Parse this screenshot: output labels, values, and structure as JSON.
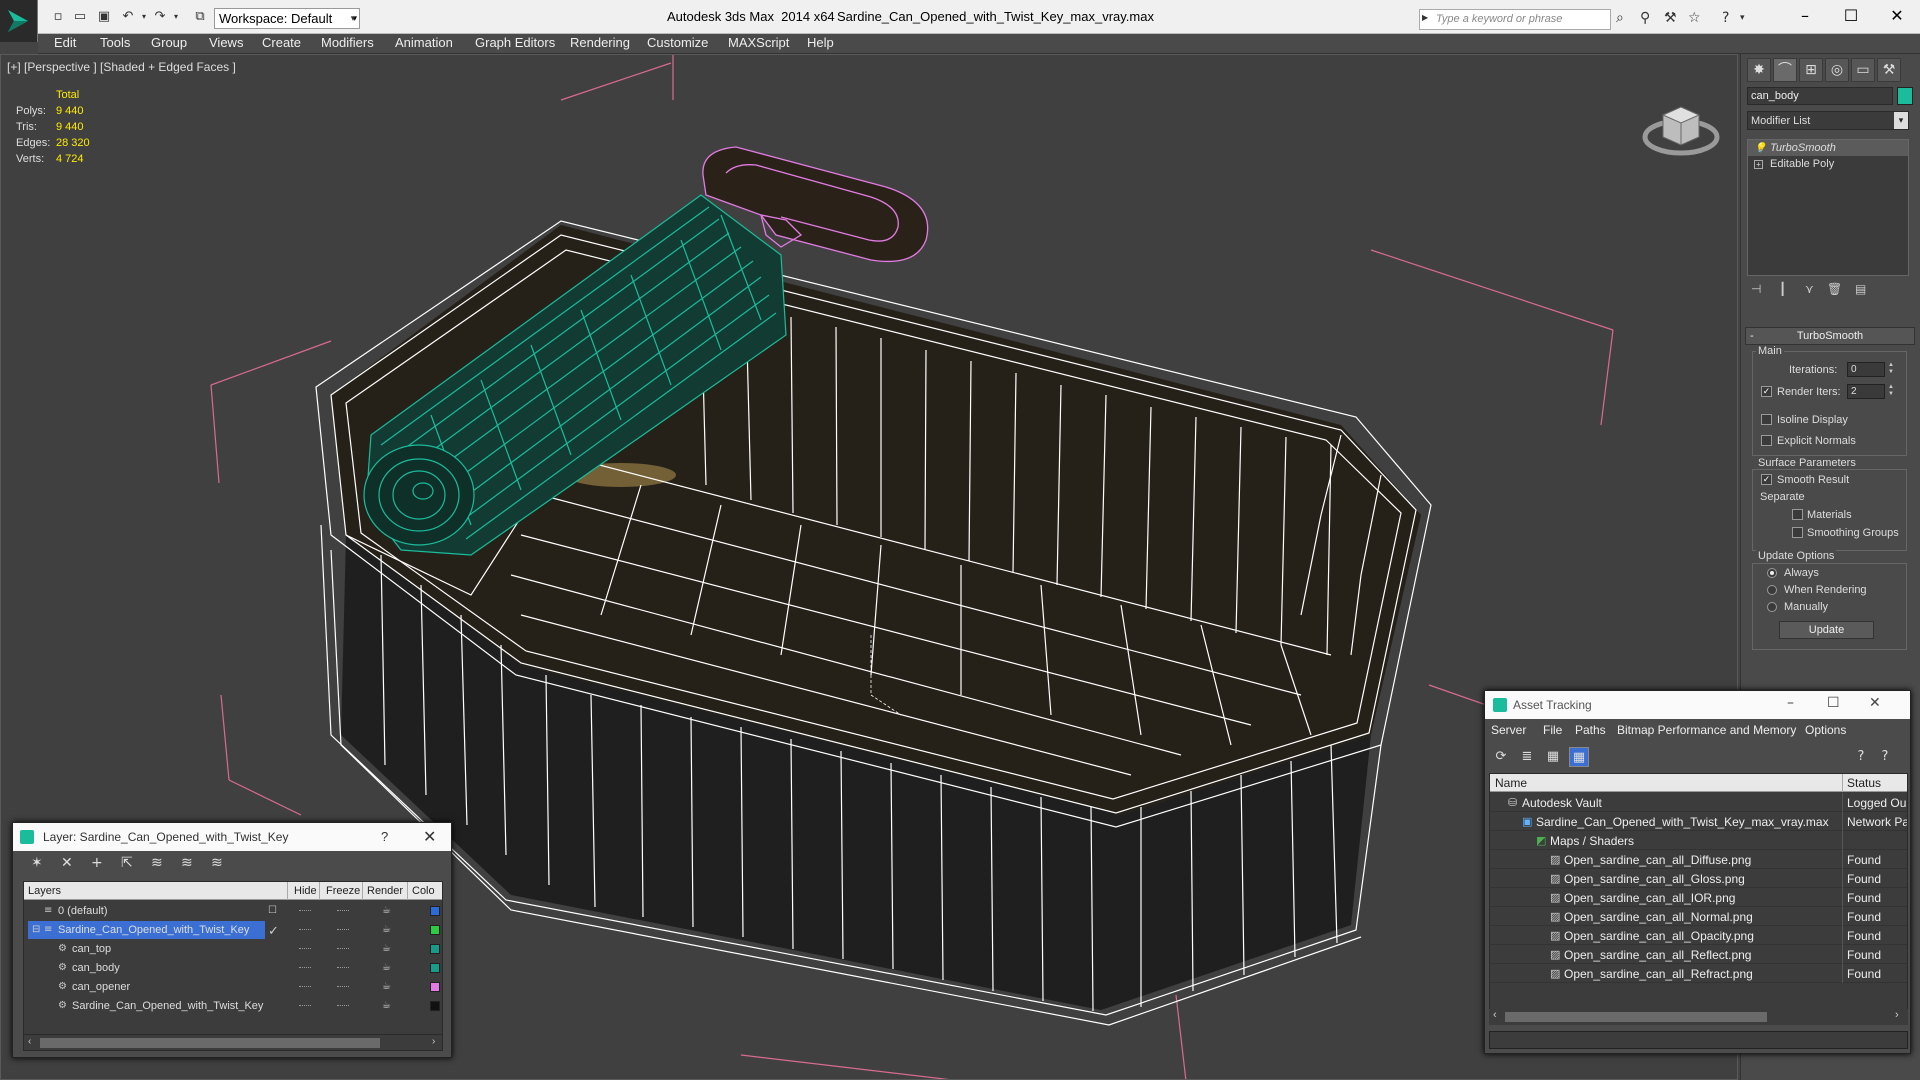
{
  "titlebar": {
    "workspace": "Workspace: Default",
    "app_title": "Autodesk 3ds Max  2014 x64",
    "file_title": "Sardine_Can_Opened_with_Twist_Key_max_vray.max",
    "search_placeholder": "Type a keyword or phrase"
  },
  "menu": [
    "Edit",
    "Tools",
    "Group",
    "Views",
    "Create",
    "Modifiers",
    "Animation",
    "Graph Editors",
    "Rendering",
    "Customize",
    "MAXScript",
    "Help"
  ],
  "viewport": {
    "label": "[+] [Perspective ] [Shaded + Edged Faces ]",
    "stats_total": "Total",
    "stats": [
      {
        "k": "Polys:",
        "v": "9 440"
      },
      {
        "k": "Tris:",
        "v": "9 440"
      },
      {
        "k": "Edges:",
        "v": "28 320"
      },
      {
        "k": "Verts:",
        "v": "4 724"
      }
    ],
    "colors": {
      "background": "#404040",
      "wire": "#ffffff",
      "key": "#1abc9c",
      "ring": "#e27be3",
      "grid": "#d96b8f"
    }
  },
  "command_panel": {
    "object_name": "can_body",
    "object_color": "#1abc9c",
    "modifier_list": "Modifier List",
    "stack": [
      "TurboSmooth",
      "Editable Poly"
    ],
    "rollout": "TurboSmooth",
    "main_label": "Main",
    "iterations_label": "Iterations:",
    "iterations_value": "0",
    "render_iters_label": "Render Iters:",
    "render_iters_value": "2",
    "isoline": "Isoline Display",
    "explicit_normals": "Explicit Normals",
    "surface_params": "Surface Parameters",
    "smooth_result": "Smooth Result",
    "separate": "Separate",
    "materials": "Materials",
    "smoothing_groups": "Smoothing Groups",
    "update_options": "Update Options",
    "always": "Always",
    "when_rendering": "When Rendering",
    "manually": "Manually",
    "update_button": "Update"
  },
  "layer_window": {
    "title": "Layer: Sardine_Can_Opened_with_Twist_Key",
    "help": "?",
    "columns": [
      "Layers",
      "Hide",
      "Freeze",
      "Render",
      "Colo"
    ],
    "rows": [
      {
        "name": "0 (default)",
        "color": "#2b6ad9"
      },
      {
        "name": "Sardine_Can_Opened_with_Twist_Key",
        "color": "#2ecc40"
      },
      {
        "name": "can_top",
        "color": "#1a9b8a"
      },
      {
        "name": "can_body",
        "color": "#1a9b8a"
      },
      {
        "name": "can_opener",
        "color": "#e27be3"
      },
      {
        "name": "Sardine_Can_Opened_with_Twist_Key",
        "color": "#111111"
      }
    ]
  },
  "asset_window": {
    "title": "Asset Tracking",
    "menu": [
      "Server",
      "File",
      "Paths",
      "Bitmap Performance and Memory",
      "Options"
    ],
    "columns": [
      "Name",
      "Status"
    ],
    "rows": [
      {
        "name": "Autodesk Vault",
        "status": "Logged Ou"
      },
      {
        "name": "Sardine_Can_Opened_with_Twist_Key_max_vray.max",
        "status": "Network Pa"
      },
      {
        "name": "Maps / Shaders",
        "status": ""
      },
      {
        "name": "Open_sardine_can_all_Diffuse.png",
        "status": "Found"
      },
      {
        "name": "Open_sardine_can_all_Gloss.png",
        "status": "Found"
      },
      {
        "name": "Open_sardine_can_all_IOR.png",
        "status": "Found"
      },
      {
        "name": "Open_sardine_can_all_Normal.png",
        "status": "Found"
      },
      {
        "name": "Open_sardine_can_all_Opacity.png",
        "status": "Found"
      },
      {
        "name": "Open_sardine_can_all_Reflect.png",
        "status": "Found"
      },
      {
        "name": "Open_sardine_can_all_Refract.png",
        "status": "Found"
      }
    ]
  }
}
